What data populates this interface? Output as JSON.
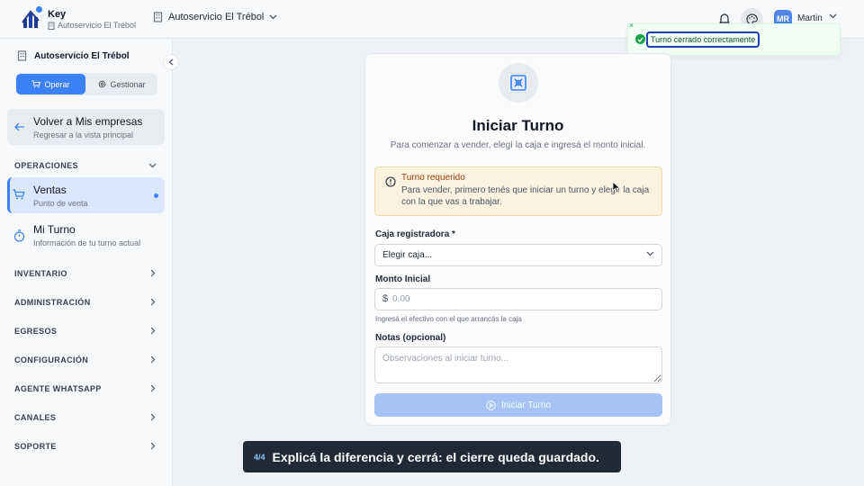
{
  "app": {
    "brand_name": "Key",
    "brand_store": "Autoservicio El Trébol",
    "store_selector": "Autoservicio El Trébol",
    "user_initials": "MR",
    "user_name": "Martin"
  },
  "toast": {
    "message": "Turno cerrado correctamente",
    "close_glyph": "×",
    "status": "success"
  },
  "sidebar": {
    "store_name": "Autoservicio El Trébol",
    "mode_tabs": [
      {
        "label": "Operar",
        "active": true,
        "icon": "cart-icon"
      },
      {
        "label": "Gestionar",
        "active": false,
        "icon": "gear-icon"
      }
    ],
    "back": {
      "title": "Volver a Mis empresas",
      "subtitle": "Regresar a la vista principal"
    },
    "operaciones": {
      "label": "OPERACIONES",
      "expanded": true,
      "items": [
        {
          "title": "Ventas",
          "subtitle": "Punto de venta",
          "active": true,
          "icon": "cart-icon"
        },
        {
          "title": "Mi Turno",
          "subtitle": "Información de tu turno actual",
          "active": false,
          "icon": "stopwatch-icon"
        }
      ]
    },
    "sections": [
      {
        "label": "INVENTARIO"
      },
      {
        "label": "ADMINISTRACIÓN"
      },
      {
        "label": "EGRESOS"
      },
      {
        "label": "CONFIGURACIÓN"
      },
      {
        "label": "AGENTE WHATSAPP"
      },
      {
        "label": "CANALES"
      },
      {
        "label": "SOPORTE"
      }
    ]
  },
  "shift_form": {
    "title": "Iniciar Turno",
    "subtitle": "Para comenzar a vender, elegí la caja e ingresá el monto inicial.",
    "alert": {
      "title": "Turno requerido",
      "body": "Para vender, primero tenés que iniciar un turno y elegir la caja con la que vas a trabajar."
    },
    "register": {
      "label": "Caja registradora *",
      "value": "Elegir caja..."
    },
    "amount": {
      "label": "Monto Inicial",
      "currency": "$",
      "value": "",
      "placeholder": "0,00",
      "help": "Ingresá el efectivo con el que arrancás la caja"
    },
    "notes": {
      "label": "Notas (opcional)",
      "value": "",
      "placeholder": "Observaciones al iniciar turno..."
    },
    "submit_label": "Iniciar Turno",
    "submit_disabled": true
  },
  "tutorial": {
    "step": "4/4",
    "text": "Explicá la diferencia y cerrá: el cierre queda guardado."
  },
  "colors": {
    "accent": "#3b82f6",
    "success": "#16a34a",
    "warning_bg": "#fdf2df",
    "warning_text": "#92400e"
  }
}
